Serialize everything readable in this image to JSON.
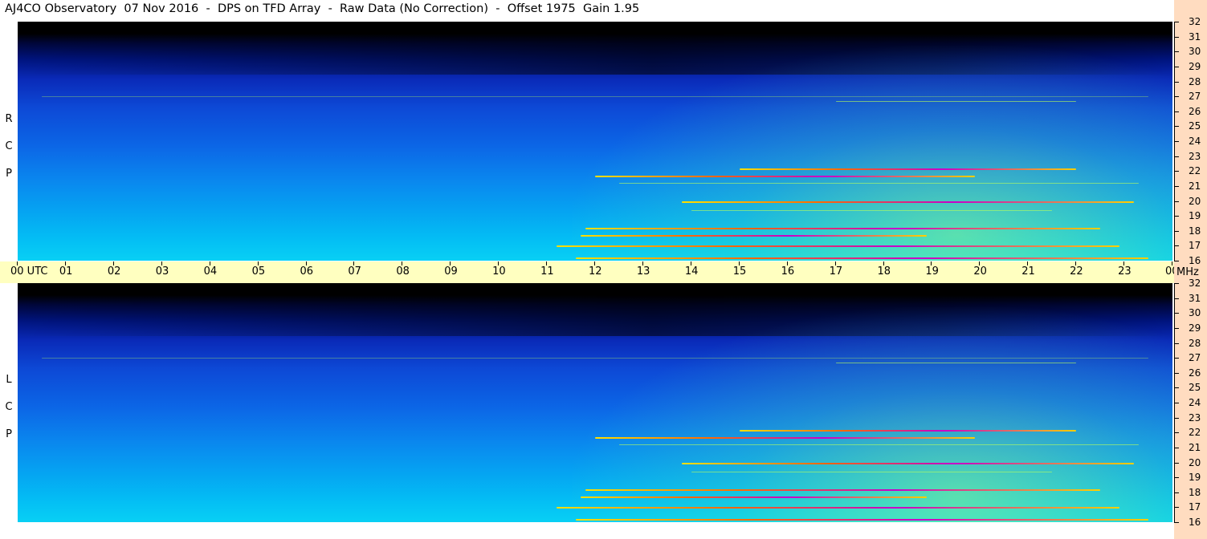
{
  "title": "AJ4CO Observatory  07 Nov 2016  -  DPS on TFD Array  -  Raw Data (No Correction)  -  Offset 1975  Gain 1.95",
  "panels": [
    {
      "label": [
        "R",
        "C",
        "P"
      ]
    },
    {
      "label": [
        "L",
        "C",
        "P"
      ]
    }
  ],
  "time_axis": {
    "labels": [
      "00  UTC",
      "01",
      "02",
      "03",
      "04",
      "05",
      "06",
      "07",
      "08",
      "09",
      "10",
      "11",
      "12",
      "13",
      "14",
      "15",
      "16",
      "17",
      "18",
      "19",
      "20",
      "21",
      "22",
      "23",
      "00"
    ],
    "unit": "MHz"
  },
  "freq_axis": {
    "labels": [
      "32",
      "31",
      "30",
      "29",
      "28",
      "27",
      "26",
      "25",
      "24",
      "23",
      "22",
      "21",
      "20",
      "19",
      "18",
      "17",
      "16"
    ]
  },
  "colors": {
    "background": "#ffffff",
    "time_bar": "#ffffc0",
    "freq_axis_bg": "#ffdcc0",
    "low_intensity": "#000000",
    "mid_intensity": "#0c66e6",
    "high_intensity": "#08d0f4",
    "rfi": "#ffe000"
  },
  "chart_data": {
    "type": "heatmap",
    "title": "AJ4CO Observatory  07 Nov 2016  -  DPS on TFD Array  -  Raw Data (No Correction)  -  Offset 1975  Gain 1.95",
    "x": [
      "00",
      "01",
      "02",
      "03",
      "04",
      "05",
      "06",
      "07",
      "08",
      "09",
      "10",
      "11",
      "12",
      "13",
      "14",
      "15",
      "16",
      "17",
      "18",
      "19",
      "20",
      "21",
      "22",
      "23",
      "00"
    ],
    "y": [
      32,
      31,
      30,
      29,
      28,
      27,
      26,
      25,
      24,
      23,
      22,
      21,
      20,
      19,
      18,
      17,
      16
    ],
    "xlabel": "UTC",
    "ylabel": "MHz",
    "xlim": [
      0,
      24
    ],
    "ylim": [
      16,
      32
    ],
    "series": [
      {
        "name": "RCP"
      },
      {
        "name": "LCP"
      }
    ],
    "rfi_lines": [
      {
        "freq": 17.0,
        "start": 11.2,
        "end": 22.9
      },
      {
        "freq": 17.7,
        "start": 11.7,
        "end": 18.9
      },
      {
        "freq": 18.2,
        "start": 11.8,
        "end": 22.5
      },
      {
        "freq": 20.0,
        "start": 13.8,
        "end": 23.2
      },
      {
        "freq": 21.7,
        "start": 12.0,
        "end": 19.9
      },
      {
        "freq": 22.2,
        "start": 15.0,
        "end": 22.0
      },
      {
        "freq": 16.2,
        "start": 11.6,
        "end": 23.5
      }
    ],
    "grid": false
  }
}
